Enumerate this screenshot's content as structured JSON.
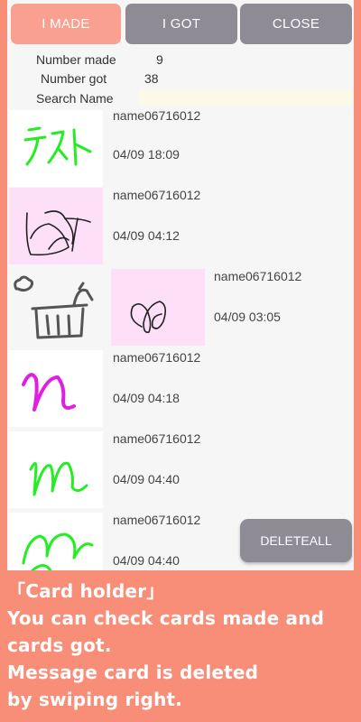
{
  "tabs": [
    {
      "label": "I MADE",
      "active": true
    },
    {
      "label": "I GOT",
      "active": false
    },
    {
      "label": "CLOSE",
      "active": false
    }
  ],
  "stats": {
    "made_label": "Number made",
    "made_value": "9",
    "got_label": "Number got",
    "got_value": "38",
    "search_label": "Search Name",
    "search_value": ""
  },
  "cards": [
    {
      "name": "name06716012",
      "date": "04/09 18:09",
      "drawing": "green-tesuto-scribble",
      "bg": "#ffffff"
    },
    {
      "name": "name06716012",
      "date": "04/09 04:12",
      "drawing": "black-scribble",
      "bg": "#fde0f8"
    },
    {
      "name": "name06716012",
      "date": "04/09 03:05",
      "drawing": "trash-bin-icon-card",
      "bg": "#fde0f8",
      "swiped": true
    },
    {
      "name": "name06716012",
      "date": "04/09 04:18",
      "drawing": "magenta-n",
      "bg": "#ffffff"
    },
    {
      "name": "name06716012",
      "date": "04/09 04:40",
      "drawing": "green-m",
      "bg": "#ffffff"
    },
    {
      "name": "name06716012",
      "date": "04/09 04:40",
      "drawing": "green-m-large",
      "bg": "#ffffff"
    }
  ],
  "delete_all_label": "DELETEALL",
  "caption": {
    "line1": "「Card holder」",
    "line2": "You can check cards made and",
    "line3": "cards got.",
    "line4": "Message card is deleted",
    "line5": "by swiping right."
  },
  "colors": {
    "background": "#f98e78",
    "active_tab": "#f9a090",
    "inactive_tab": "#8e8b95"
  }
}
